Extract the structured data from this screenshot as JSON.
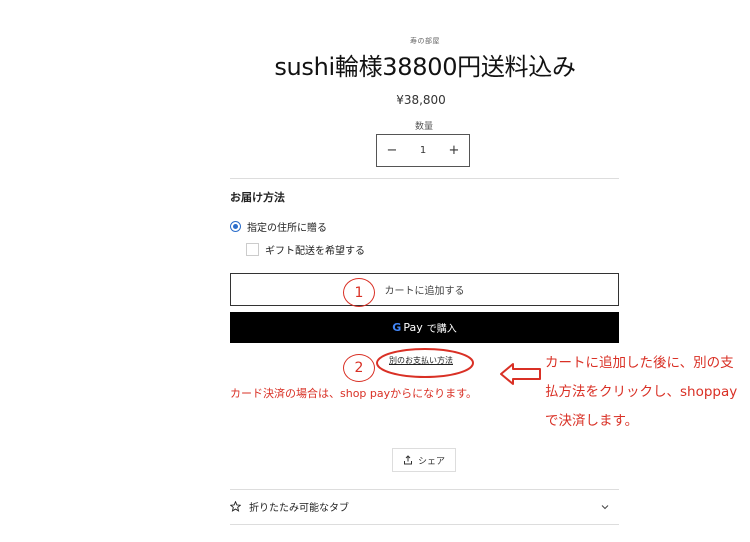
{
  "product": {
    "vendor": "寿の部屋",
    "title": "sushi輪様38800円送料込み",
    "price": "¥38,800",
    "quantity_label": "数量",
    "quantity_value": "1",
    "minus": "−",
    "plus": "+"
  },
  "delivery": {
    "title": "お届け方法",
    "option_ship": "指定の住所に贈る",
    "option_gift": "ギフト配送を希望する"
  },
  "buttons": {
    "add_to_cart": "カートに追加する",
    "gpay_g": "G",
    "gpay_pay": "Pay",
    "gpay_buy": "で購入",
    "more_payment": "別のお支払い方法",
    "share": "シェア"
  },
  "accordion": {
    "label": "折りたたみ可能なタブ"
  },
  "annotations": {
    "num1": "1",
    "num2": "2",
    "note_left": "カード決済の場合は、shop payからになります。",
    "note_right_line1": "カートに追加した後に、別の支",
    "note_right_line2": "払方法をクリックし、shoppay",
    "note_right_line3": "で決済します。",
    "color": "#d93025"
  },
  "colors": {
    "radio_accent": "#2c6ecb",
    "gpay_bg": "#000000"
  },
  "icons": {
    "share": "share-icon",
    "star": "star-icon",
    "chevron": "chevron-down-icon",
    "arrow": "left-arrow-outline-icon"
  }
}
